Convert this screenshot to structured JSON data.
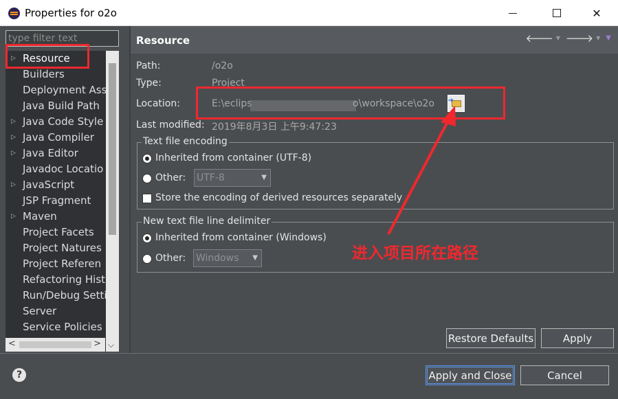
{
  "window": {
    "title": "Properties for o2o",
    "minimize_label": "Minimize",
    "maximize_label": "Maximize",
    "close_glyph": "✕"
  },
  "filter": {
    "placeholder": "type filter text"
  },
  "tree": {
    "items": [
      {
        "label": "Resource",
        "expandable": true,
        "selected": true
      },
      {
        "label": "Builders",
        "expandable": false
      },
      {
        "label": "Deployment Ass",
        "expandable": false
      },
      {
        "label": "Java Build Path",
        "expandable": false
      },
      {
        "label": "Java Code Style",
        "expandable": true
      },
      {
        "label": "Java Compiler",
        "expandable": true
      },
      {
        "label": "Java Editor",
        "expandable": true
      },
      {
        "label": "Javadoc Locatio",
        "expandable": false
      },
      {
        "label": "JavaScript",
        "expandable": true
      },
      {
        "label": "JSP Fragment",
        "expandable": false
      },
      {
        "label": "Maven",
        "expandable": true
      },
      {
        "label": "Project Facets",
        "expandable": false
      },
      {
        "label": "Project Natures",
        "expandable": false
      },
      {
        "label": "Project Referen",
        "expandable": false
      },
      {
        "label": "Refactoring Hist",
        "expandable": false
      },
      {
        "label": "Run/Debug Setti",
        "expandable": false
      },
      {
        "label": "Server",
        "expandable": false
      },
      {
        "label": "Service Policies",
        "expandable": false
      }
    ]
  },
  "page": {
    "title": "Resource",
    "nav": {
      "back": "🡐",
      "forward": "🡒",
      "menu": "▼",
      "dropdown": "▼"
    },
    "path_label": "Path:",
    "path_value": "/o2o",
    "type_label": "Type:",
    "type_value": "Project",
    "location_label": "Location:",
    "location_prefix": "E:\\eclips",
    "location_suffix": "o\\workspace\\o2o",
    "modified_label": "Last modified:",
    "modified_value": "2019年8月3日 上午9:47:23",
    "encoding_group": {
      "title": "Text file encoding",
      "inherited_label": "Inherited from container (UTF-8)",
      "other_label": "Other:",
      "other_value": "UTF-8",
      "store_label": "Store the encoding of derived resources separately"
    },
    "delimiter_group": {
      "title": "New text file line delimiter",
      "inherited_label": "Inherited from container (Windows)",
      "other_label": "Other:",
      "other_value": "Windows"
    },
    "restore_label": "Restore Defaults",
    "apply_label": "Apply"
  },
  "footer": {
    "help_glyph": "?",
    "apply_close_label": "Apply and Close",
    "cancel_label": "Cancel"
  },
  "annotation": {
    "text": "进入项目所在路径",
    "color": "#f0282e"
  }
}
